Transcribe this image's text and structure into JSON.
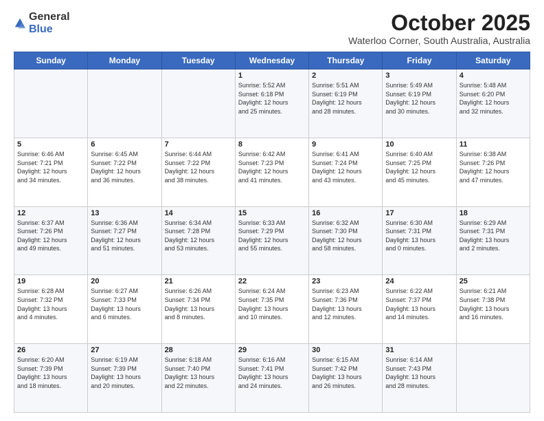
{
  "logo": {
    "general": "General",
    "blue": "Blue"
  },
  "title": {
    "month": "October 2025",
    "location": "Waterloo Corner, South Australia, Australia"
  },
  "days_header": [
    "Sunday",
    "Monday",
    "Tuesday",
    "Wednesday",
    "Thursday",
    "Friday",
    "Saturday"
  ],
  "weeks": [
    [
      {
        "day": "",
        "info": ""
      },
      {
        "day": "",
        "info": ""
      },
      {
        "day": "",
        "info": ""
      },
      {
        "day": "1",
        "info": "Sunrise: 5:52 AM\nSunset: 6:18 PM\nDaylight: 12 hours\nand 25 minutes."
      },
      {
        "day": "2",
        "info": "Sunrise: 5:51 AM\nSunset: 6:19 PM\nDaylight: 12 hours\nand 28 minutes."
      },
      {
        "day": "3",
        "info": "Sunrise: 5:49 AM\nSunset: 6:19 PM\nDaylight: 12 hours\nand 30 minutes."
      },
      {
        "day": "4",
        "info": "Sunrise: 5:48 AM\nSunset: 6:20 PM\nDaylight: 12 hours\nand 32 minutes."
      }
    ],
    [
      {
        "day": "5",
        "info": "Sunrise: 6:46 AM\nSunset: 7:21 PM\nDaylight: 12 hours\nand 34 minutes."
      },
      {
        "day": "6",
        "info": "Sunrise: 6:45 AM\nSunset: 7:22 PM\nDaylight: 12 hours\nand 36 minutes."
      },
      {
        "day": "7",
        "info": "Sunrise: 6:44 AM\nSunset: 7:22 PM\nDaylight: 12 hours\nand 38 minutes."
      },
      {
        "day": "8",
        "info": "Sunrise: 6:42 AM\nSunset: 7:23 PM\nDaylight: 12 hours\nand 41 minutes."
      },
      {
        "day": "9",
        "info": "Sunrise: 6:41 AM\nSunset: 7:24 PM\nDaylight: 12 hours\nand 43 minutes."
      },
      {
        "day": "10",
        "info": "Sunrise: 6:40 AM\nSunset: 7:25 PM\nDaylight: 12 hours\nand 45 minutes."
      },
      {
        "day": "11",
        "info": "Sunrise: 6:38 AM\nSunset: 7:26 PM\nDaylight: 12 hours\nand 47 minutes."
      }
    ],
    [
      {
        "day": "12",
        "info": "Sunrise: 6:37 AM\nSunset: 7:26 PM\nDaylight: 12 hours\nand 49 minutes."
      },
      {
        "day": "13",
        "info": "Sunrise: 6:36 AM\nSunset: 7:27 PM\nDaylight: 12 hours\nand 51 minutes."
      },
      {
        "day": "14",
        "info": "Sunrise: 6:34 AM\nSunset: 7:28 PM\nDaylight: 12 hours\nand 53 minutes."
      },
      {
        "day": "15",
        "info": "Sunrise: 6:33 AM\nSunset: 7:29 PM\nDaylight: 12 hours\nand 55 minutes."
      },
      {
        "day": "16",
        "info": "Sunrise: 6:32 AM\nSunset: 7:30 PM\nDaylight: 12 hours\nand 58 minutes."
      },
      {
        "day": "17",
        "info": "Sunrise: 6:30 AM\nSunset: 7:31 PM\nDaylight: 13 hours\nand 0 minutes."
      },
      {
        "day": "18",
        "info": "Sunrise: 6:29 AM\nSunset: 7:31 PM\nDaylight: 13 hours\nand 2 minutes."
      }
    ],
    [
      {
        "day": "19",
        "info": "Sunrise: 6:28 AM\nSunset: 7:32 PM\nDaylight: 13 hours\nand 4 minutes."
      },
      {
        "day": "20",
        "info": "Sunrise: 6:27 AM\nSunset: 7:33 PM\nDaylight: 13 hours\nand 6 minutes."
      },
      {
        "day": "21",
        "info": "Sunrise: 6:26 AM\nSunset: 7:34 PM\nDaylight: 13 hours\nand 8 minutes."
      },
      {
        "day": "22",
        "info": "Sunrise: 6:24 AM\nSunset: 7:35 PM\nDaylight: 13 hours\nand 10 minutes."
      },
      {
        "day": "23",
        "info": "Sunrise: 6:23 AM\nSunset: 7:36 PM\nDaylight: 13 hours\nand 12 minutes."
      },
      {
        "day": "24",
        "info": "Sunrise: 6:22 AM\nSunset: 7:37 PM\nDaylight: 13 hours\nand 14 minutes."
      },
      {
        "day": "25",
        "info": "Sunrise: 6:21 AM\nSunset: 7:38 PM\nDaylight: 13 hours\nand 16 minutes."
      }
    ],
    [
      {
        "day": "26",
        "info": "Sunrise: 6:20 AM\nSunset: 7:39 PM\nDaylight: 13 hours\nand 18 minutes."
      },
      {
        "day": "27",
        "info": "Sunrise: 6:19 AM\nSunset: 7:39 PM\nDaylight: 13 hours\nand 20 minutes."
      },
      {
        "day": "28",
        "info": "Sunrise: 6:18 AM\nSunset: 7:40 PM\nDaylight: 13 hours\nand 22 minutes."
      },
      {
        "day": "29",
        "info": "Sunrise: 6:16 AM\nSunset: 7:41 PM\nDaylight: 13 hours\nand 24 minutes."
      },
      {
        "day": "30",
        "info": "Sunrise: 6:15 AM\nSunset: 7:42 PM\nDaylight: 13 hours\nand 26 minutes."
      },
      {
        "day": "31",
        "info": "Sunrise: 6:14 AM\nSunset: 7:43 PM\nDaylight: 13 hours\nand 28 minutes."
      },
      {
        "day": "",
        "info": ""
      }
    ]
  ]
}
